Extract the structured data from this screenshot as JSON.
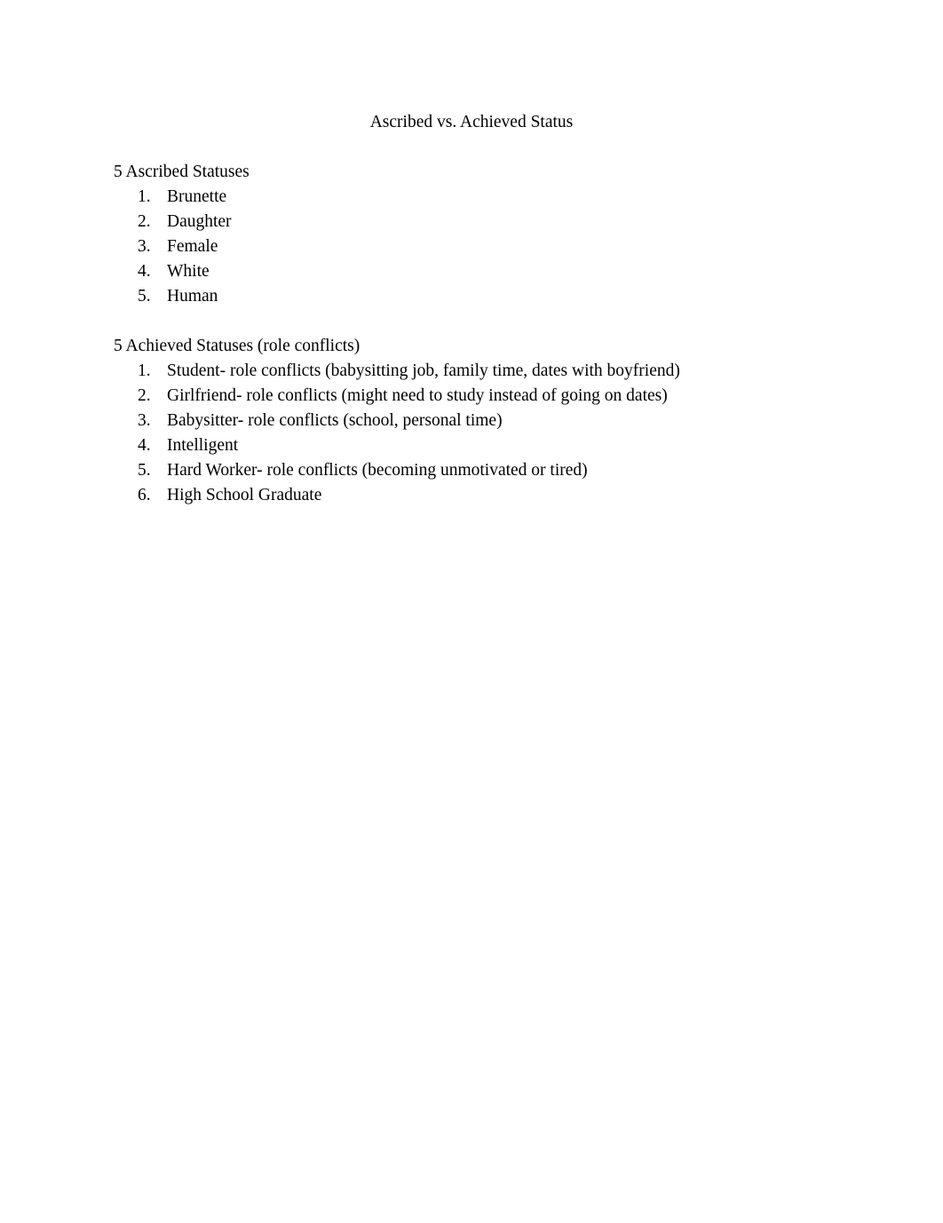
{
  "document": {
    "title": "Ascribed vs. Achieved Status",
    "page_background": "#ffffff",
    "text_color": "#000000",
    "sections": [
      {
        "heading": "5 Ascribed Statuses",
        "items": [
          {
            "number": "1.",
            "text": "Brunette"
          },
          {
            "number": "2.",
            "text": "Daughter"
          },
          {
            "number": "3.",
            "text": "Female"
          },
          {
            "number": "4.",
            "text": "White"
          },
          {
            "number": "5.",
            "text": "Human"
          }
        ]
      },
      {
        "heading": "5 Achieved Statuses (role conflicts)",
        "items": [
          {
            "number": "1.",
            "text": "Student- role conflicts (babysitting job, family time, dates with boyfriend)"
          },
          {
            "number": "2.",
            "text": "Girlfriend- role conflicts (might need to study instead of going on dates)"
          },
          {
            "number": "3.",
            "text": "Babysitter- role conflicts (school, personal time)"
          },
          {
            "number": "4.",
            "text": "Intelligent"
          },
          {
            "number": "5.",
            "text": "Hard Worker- role conflicts (becoming unmotivated or tired)"
          },
          {
            "number": "6.",
            "text": "High School Graduate"
          }
        ]
      }
    ]
  }
}
